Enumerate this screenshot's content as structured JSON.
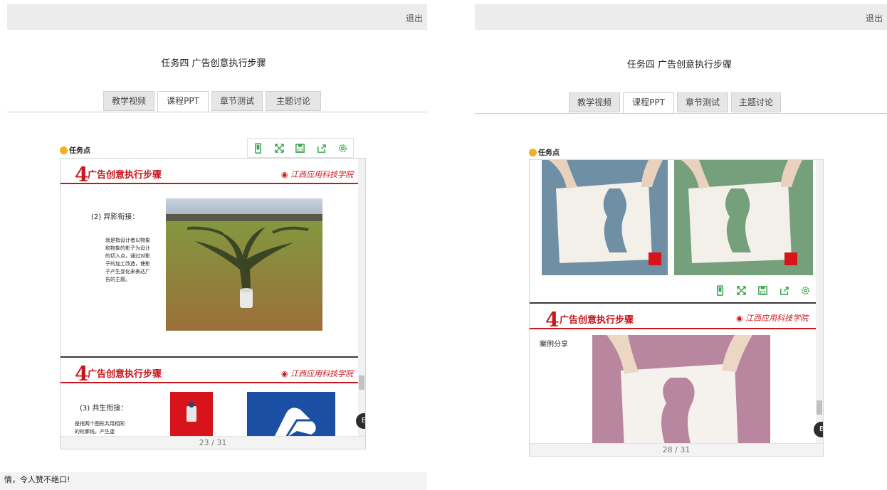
{
  "left": {
    "logout": "退出",
    "title": "任务四 广告创意执行步骤",
    "tabs": [
      "教学视频",
      "课程PPT",
      "章节测试",
      "主题讨论"
    ],
    "active_tab": "课程PPT",
    "taskpoint": "任务点",
    "slide1": {
      "number": "4",
      "title": "广告创意执行步骤",
      "logo": "江西应用科技学院",
      "subtitle": "(2) 异影衔接：",
      "body": "就是指设计者以物象和物象的影子为设计的切入点，通过对影子的加工改造，使影子产生变化来表达广告的主题。"
    },
    "slide2": {
      "number": "4",
      "title": "广告创意执行步骤",
      "logo": "江西应用科技学院",
      "subtitle": "(3) 共生衔接：",
      "body": "是指两个图形共用相同的轮廓线，产生虚"
    },
    "pager": "23 / 31",
    "bottom_text": "情，令人赞不绝口!"
  },
  "right": {
    "logout": "退出",
    "title": "任务四 广告创意执行步骤",
    "tabs": [
      "教学视频",
      "课程PPT",
      "章节测试",
      "主题讨论"
    ],
    "active_tab": "课程PPT",
    "taskpoint": "任务点",
    "slide": {
      "number": "4",
      "title": "广告创意执行步骤",
      "logo": "江西应用科技学院",
      "case_label": "案例分享"
    },
    "pager": "28 / 31"
  },
  "toolbar_icons": [
    "phone-icon",
    "fullscreen-icon",
    "save-icon",
    "share-icon",
    "settings-icon"
  ],
  "colors": {
    "accent_red": "#c8161d",
    "icon_green": "#3aa84c",
    "task_dot": "#f2b01e"
  }
}
